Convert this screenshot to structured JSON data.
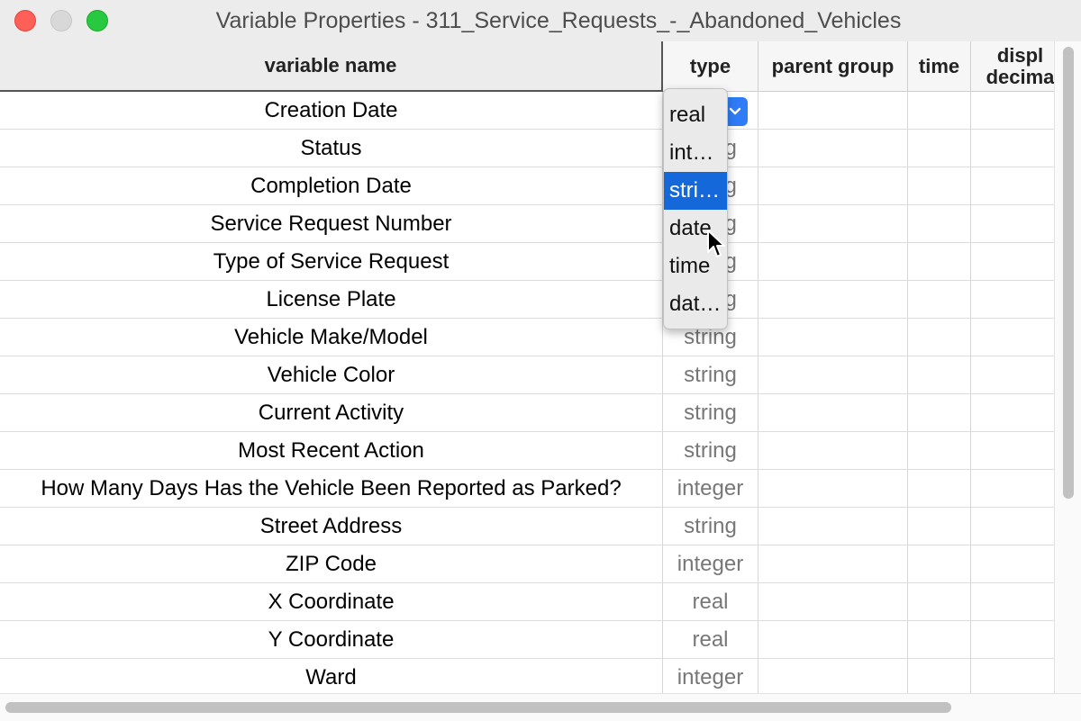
{
  "window": {
    "title": "Variable Properties - 311_Service_Requests_-_Abandoned_Vehicles"
  },
  "headers": {
    "variable_name": "variable name",
    "type": "type",
    "parent_group": "parent group",
    "time": "time",
    "display_decimals": "displ decima"
  },
  "rows": [
    {
      "name": "Creation Date",
      "type": ""
    },
    {
      "name": "Status",
      "type": "string"
    },
    {
      "name": "Completion Date",
      "type": "string"
    },
    {
      "name": "Service Request Number",
      "type": "string"
    },
    {
      "name": "Type of Service Request",
      "type": "string"
    },
    {
      "name": "License Plate",
      "type": "string"
    },
    {
      "name": "Vehicle Make/Model",
      "type": "string"
    },
    {
      "name": "Vehicle Color",
      "type": "string"
    },
    {
      "name": "Current Activity",
      "type": "string"
    },
    {
      "name": "Most Recent Action",
      "type": "string"
    },
    {
      "name": "How Many Days Has the Vehicle Been Reported as Parked?",
      "type": "integer"
    },
    {
      "name": "Street Address",
      "type": "string"
    },
    {
      "name": "ZIP Code",
      "type": "integer"
    },
    {
      "name": "X Coordinate",
      "type": "real"
    },
    {
      "name": "Y Coordinate",
      "type": "real"
    },
    {
      "name": "Ward",
      "type": "integer"
    }
  ],
  "type_dropdown": {
    "options": [
      "real",
      "int…",
      "stri…",
      "date",
      "time",
      "dat…"
    ],
    "selected_index": 2
  },
  "icons": {
    "dropdown_arrow": "chevron-down-icon",
    "pointer": "mouse-cursor-icon"
  },
  "colors": {
    "selection": "#1468d9",
    "close": "#fe5f57",
    "maximize": "#28c840"
  }
}
